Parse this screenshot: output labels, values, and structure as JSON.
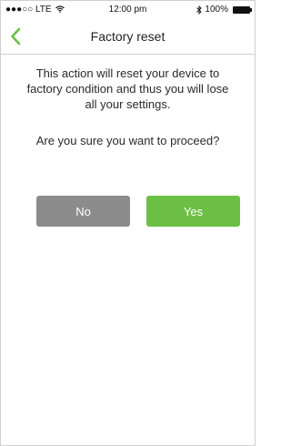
{
  "status_bar": {
    "carrier": "●●●○○ LTE",
    "time": "12:00 pm",
    "battery_percent": "100%"
  },
  "nav": {
    "back_icon": "chevron-left-icon",
    "title": "Factory reset"
  },
  "content": {
    "message": "This action will reset your device to factory condition and thus you will lose all your settings.",
    "question": "Are you sure you want to proceed?"
  },
  "buttons": {
    "no_label": "No",
    "yes_label": "Yes"
  },
  "colors": {
    "accent_green": "#6bbf44",
    "button_gray": "#8c8c8c"
  }
}
